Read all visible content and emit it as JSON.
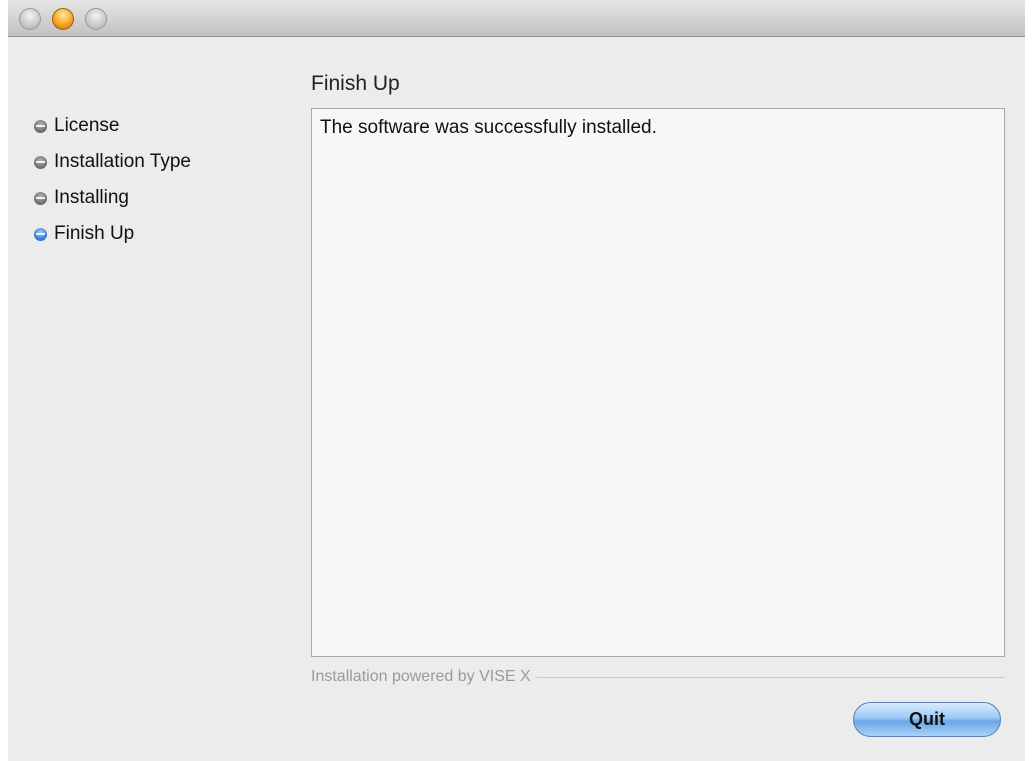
{
  "window": {
    "controls": {
      "close_icon": "close-button-icon",
      "minimize_icon": "minimize-button-icon",
      "zoom_icon": "zoom-button-icon"
    }
  },
  "sidebar": {
    "items": [
      {
        "label": "License",
        "state": "completed",
        "bullet_color": "#6f6f6f"
      },
      {
        "label": "Installation Type",
        "state": "completed",
        "bullet_color": "#6f6f6f"
      },
      {
        "label": "Installing",
        "state": "completed",
        "bullet_color": "#6f6f6f"
      },
      {
        "label": "Finish Up",
        "state": "current",
        "bullet_color": "#3a7fd6"
      }
    ]
  },
  "main": {
    "title": "Finish Up",
    "message": "The software was successfully installed."
  },
  "footer": {
    "powered_by": "Installation powered by VISE X"
  },
  "buttons": {
    "quit_label": "Quit"
  }
}
